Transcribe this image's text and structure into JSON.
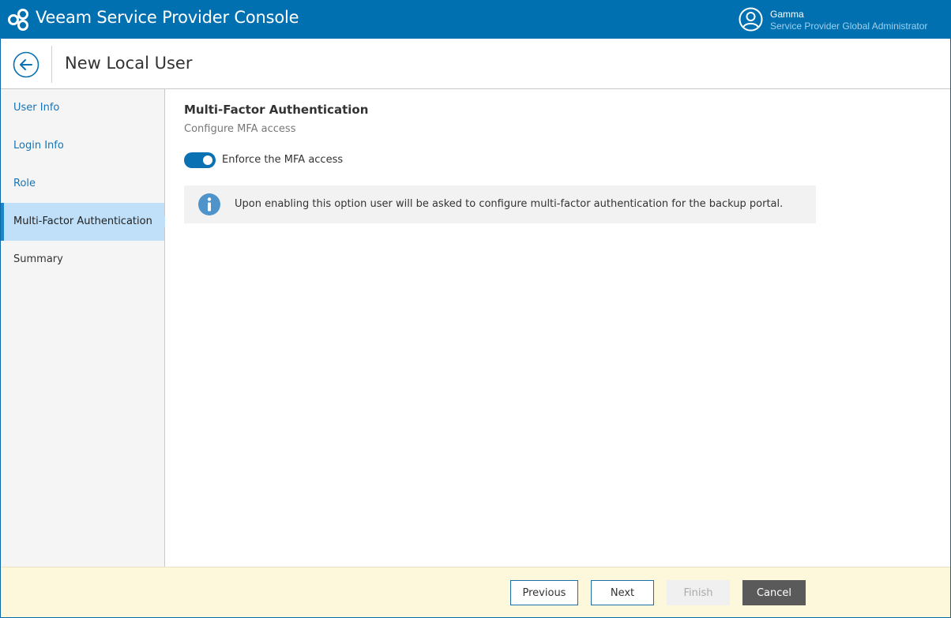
{
  "app": {
    "title": "Veeam Service Provider Console"
  },
  "user": {
    "name": "Gamma",
    "role": "Service Provider Global Administrator"
  },
  "header": {
    "title": "New Local User"
  },
  "sidebar": {
    "items": [
      {
        "label": "User Info",
        "state": "link"
      },
      {
        "label": "Login Info",
        "state": "link"
      },
      {
        "label": "Role",
        "state": "link"
      },
      {
        "label": "Multi-Factor Authentication",
        "state": "active"
      },
      {
        "label": "Summary",
        "state": "plain"
      }
    ]
  },
  "main": {
    "title": "Multi-Factor Authentication",
    "subtitle": "Configure MFA access",
    "toggle": {
      "label": "Enforce the MFA access",
      "enabled": true
    },
    "info": {
      "text": "Upon enabling this option user will be asked to configure multi-factor authentication for the backup portal."
    }
  },
  "footer": {
    "previous_label": "Previous",
    "next_label": "Next",
    "finish_label": "Finish",
    "cancel_label": "Cancel"
  },
  "colors": {
    "brand": "#0070b0",
    "active_nav": "#bfe0f8",
    "footer_bg": "#fdf8dc",
    "info_icon": "#4e93c9"
  },
  "icons": {
    "logo": "veeam-logo-icon",
    "avatar": "user-avatar-icon",
    "back": "back-arrow-icon",
    "info": "info-icon"
  }
}
